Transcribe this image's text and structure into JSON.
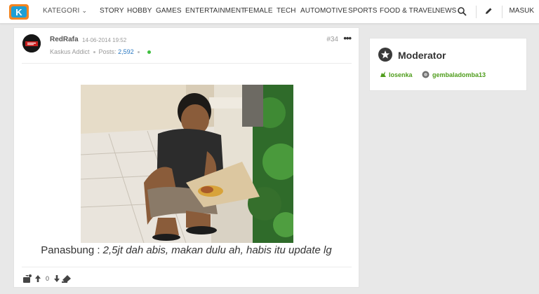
{
  "nav": {
    "kategori": "KATEGORI",
    "items": [
      "STORY",
      "HOBBY",
      "GAMES",
      "ENTERTAINMENT",
      "FEMALE",
      "TECH",
      "AUTOMOTIVE",
      "SPORTS",
      "FOOD & TRAVEL",
      "NEWS"
    ],
    "masuk": "MASUK"
  },
  "post": {
    "username": "RedRafa",
    "date": "14-06-2014 19:52",
    "number": "#34",
    "rank": "Kaskus Addict",
    "posts_label": "Posts:",
    "posts_count": "2,592",
    "caption_lead": "Panasbung : ",
    "caption_rest": "2,5jt dah abis, makan dulu ah, habis itu update lg",
    "vote_count": "0"
  },
  "sidebar": {
    "title": "Moderator",
    "moderators": [
      "losenka",
      "gembaladomba13"
    ]
  },
  "colors": {
    "brand_orange": "#f4841f",
    "brand_blue": "#1e9fd4",
    "moderator_green": "#4f9d1c",
    "online_green": "#3fbf3f",
    "link_blue": "#2b79c2"
  },
  "icons": {
    "logo": "kaskus-logo",
    "search": "search-icon",
    "write": "pencil-icon",
    "more": "more-dots-icon",
    "upvote": "arrow-up-icon",
    "downvote": "arrow-down-icon",
    "quote": "quote-icon",
    "moderator_badge": "star-icon"
  }
}
